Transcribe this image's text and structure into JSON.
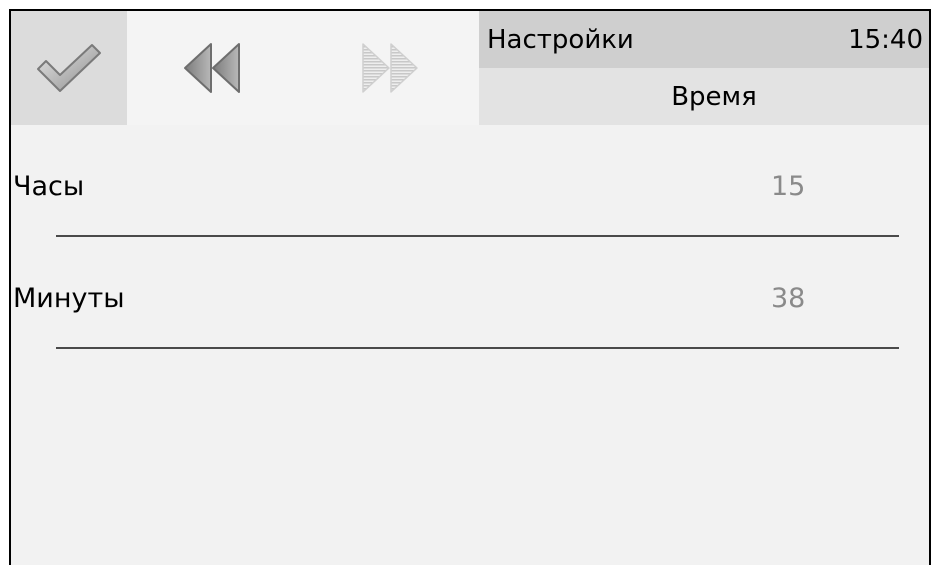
{
  "toolbar": {
    "confirm_icon": "checkmark-icon",
    "back_icon": "double-left-arrow-icon",
    "forward_icon": "double-right-arrow-icon"
  },
  "header": {
    "title": "Настройки",
    "clock": "15:40",
    "subtitle": "Время"
  },
  "fields": [
    {
      "label": "Часы",
      "value": "15"
    },
    {
      "label": "Минуты",
      "value": "38"
    }
  ],
  "colors": {
    "background": "#f2f2f2",
    "header_top": "#cfcfcf",
    "header_bottom": "#e3e3e3",
    "confirm_button": "#dcdcdc",
    "value_text": "#8a8a8a"
  }
}
